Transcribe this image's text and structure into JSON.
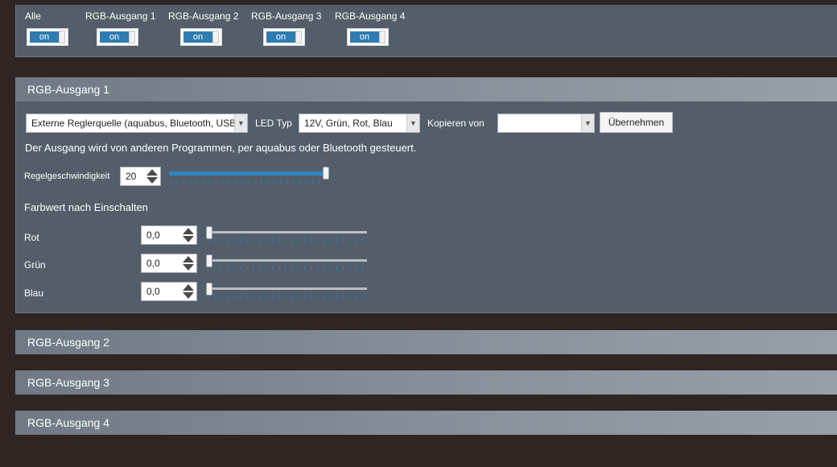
{
  "toggles": [
    {
      "label": "Alle",
      "state": "on"
    },
    {
      "label": "RGB-Ausgang 1",
      "state": "on"
    },
    {
      "label": "RGB-Ausgang 2",
      "state": "on"
    },
    {
      "label": "RGB-Ausgang 3",
      "state": "on"
    },
    {
      "label": "RGB-Ausgang 4",
      "state": "on"
    }
  ],
  "panel1": {
    "title": "RGB-Ausgang 1",
    "source_select": "Externe Reglerquelle (aquabus, Bluetooth, USB)",
    "led_typ_label": "LED Typ",
    "led_typ_value": "12V, Grün, Rot, Blau",
    "kopieren_label": "Kopieren von",
    "kopieren_value": "",
    "uebernehmen_label": "Übernehmen",
    "info_text": "Der Ausgang wird von anderen Programmen, per aquabus oder Bluetooth gesteuert.",
    "speed_label": "Regelgeschwindigkeit",
    "speed_value": "20",
    "speed_slider_fraction": 1.0,
    "farbwert_title": "Farbwert nach Einschalten",
    "colors": [
      {
        "label": "Rot",
        "value": "0,0",
        "slider_fraction": 0.0
      },
      {
        "label": "Grün",
        "value": "0,0",
        "slider_fraction": 0.0
      },
      {
        "label": "Blau",
        "value": "0,0",
        "slider_fraction": 0.0
      }
    ]
  },
  "panel2": {
    "title": "RGB-Ausgang 2"
  },
  "panel3": {
    "title": "RGB-Ausgang 3"
  },
  "panel4": {
    "title": "RGB-Ausgang 4"
  },
  "colors_theme": {
    "accent": "#2e7cb0",
    "panel": "#535e6a",
    "background": "#2f2624"
  }
}
